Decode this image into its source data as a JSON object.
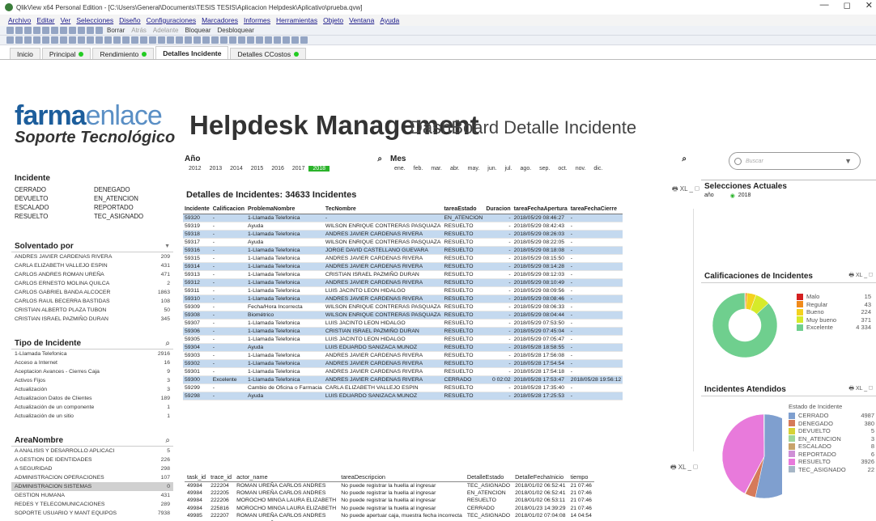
{
  "window": {
    "title": "QlikView x64 Personal Edition - [C:\\Users\\General\\Documents\\TESIS TESIS\\Aplicacion Helpdesk\\Aplicativo\\prueba.qvw]",
    "min": "—",
    "max": "◻",
    "close": "✕"
  },
  "menu": [
    "Archivo",
    "Editar",
    "Ver",
    "Selecciones",
    "Diseño",
    "Configuraciones",
    "Marcadores",
    "Informes",
    "Herramientas",
    "Objeto",
    "Ventana",
    "Ayuda"
  ],
  "toolbar": {
    "borrar": "Borrar",
    "atras": "Atrás",
    "adelante": "Adelante",
    "bloquear": "Bloquear",
    "desbloquear": "Desbloquear"
  },
  "tabs": [
    {
      "label": "Inicio",
      "dot": false
    },
    {
      "label": "Principal",
      "dot": true
    },
    {
      "label": "Rendimiento",
      "dot": true
    },
    {
      "label": "Detalles Incidente",
      "dot": false,
      "active": true
    },
    {
      "label": "Detalles CCostos",
      "dot": true
    }
  ],
  "logo": {
    "farma": "farma",
    "enlace": "enlace",
    "sub": "Soporte Tecnológico"
  },
  "title": "Helpdesk Management",
  "subtitle": "DashBoard Detalle Incidente",
  "search": {
    "placeholder": "Buscar"
  },
  "anio": {
    "label": "Año",
    "values": [
      "2012",
      "2013",
      "2014",
      "2015",
      "2016",
      "2017",
      "2018"
    ],
    "selected": "2018"
  },
  "mes": {
    "label": "Mes",
    "values": [
      "ene.",
      "feb.",
      "mar.",
      "abr.",
      "may.",
      "jun.",
      "jul.",
      "ago.",
      "sep.",
      "oct.",
      "nov.",
      "dic."
    ]
  },
  "incidente": {
    "label": "Incidente",
    "items": [
      "CERRADO",
      "DENEGADO",
      "DEVUELTO",
      "EN_ATENCION",
      "ESCALADO",
      "REPORTADO",
      "RESUELTO",
      "TEC_ASIGNADO"
    ]
  },
  "solventado": {
    "label": "Solventado por",
    "rows": [
      [
        "ANDRES JAVIER CARDENAS RIVERA",
        "209"
      ],
      [
        "CARLA ELIZABETH VALLEJO ESPIN",
        "431"
      ],
      [
        "CARLOS ANDRES ROMAN UREÑA",
        "471"
      ],
      [
        "CARLOS ERNESTO MOLINA QUILCA",
        "2"
      ],
      [
        "CARLOS GABRIEL BANDA ALCOCER",
        "1863"
      ],
      [
        "CARLOS RAUL BECERRA BASTIDAS",
        "108"
      ],
      [
        "CRISTIAN ALBERTO PLAZA TUBON",
        "50"
      ],
      [
        "CRISTIAN ISRAEL PAZMIÑO DURAN",
        "345"
      ]
    ]
  },
  "tipo": {
    "label": "Tipo de Incidente",
    "rows": [
      [
        "1-Llamada Telefonica",
        "2916"
      ],
      [
        "Acceso a Internet",
        "16"
      ],
      [
        "Aceptacion Avances - Cierres Caja",
        "9"
      ],
      [
        "Activos Fijos",
        "3"
      ],
      [
        "Actualización",
        "3"
      ],
      [
        "Actualizacion Datos de Clientes",
        "189"
      ],
      [
        "Actualización de un componente",
        "1"
      ],
      [
        "Actualización de un sitio",
        "1"
      ]
    ]
  },
  "area": {
    "label": "AreaNombre",
    "rows": [
      [
        "A ANALISIS Y DESARROLLO APLICACI",
        "5"
      ],
      [
        "A GESTION DE IDENTIDADES",
        "226"
      ],
      [
        "A SEGURIDAD",
        "298"
      ],
      [
        "ADMINISTRACION OPERACIONES",
        "107"
      ],
      [
        "ADMINISTRACION SISTEMAS",
        "0"
      ],
      [
        "GESTION HUMANA",
        "431"
      ],
      [
        "REDES Y TELECOMUNICACIONES",
        "289"
      ],
      [
        "SOPORTE USUARIO Y MANT EQUIPOS",
        "7938"
      ]
    ]
  },
  "detalle": {
    "title": "Detalles de Incidentes: 34633 Incidentes",
    "icons": "🖶 XL _ ◻",
    "headers": [
      "Incidente",
      "Calificacion",
      "ProblemaNombre",
      "TecNombre",
      "tareaEstado",
      "Duracion",
      "tareaFechaApertura",
      "tareaFechaCierre"
    ],
    "rows": [
      [
        "59320",
        "-",
        "1-Llamada Telefonica",
        "-",
        "EN_ATENCION",
        "-",
        "2018/05/29 08:46:27",
        "-"
      ],
      [
        "59319",
        "-",
        "Ayuda",
        "WILSON ENRIQUE CONTRERAS PASQUAZA",
        "RESUELTO",
        "-",
        "2018/05/29 08:42:43",
        "-"
      ],
      [
        "59318",
        "-",
        "1-Llamada Telefonica",
        "ANDRES JAVIER CARDENAS RIVERA",
        "RESUELTO",
        "-",
        "2018/05/29 08:26:03",
        "-"
      ],
      [
        "59317",
        "-",
        "Ayuda",
        "WILSON ENRIQUE CONTRERAS PASQUAZA",
        "RESUELTO",
        "-",
        "2018/05/29 08:22:05",
        "-"
      ],
      [
        "59316",
        "-",
        "1-Llamada Telefonica",
        "JORGE DAVID CASTELLANO GUEVARA",
        "RESUELTO",
        "-",
        "2018/05/29 08:18:08",
        "-"
      ],
      [
        "59315",
        "-",
        "1-Llamada Telefonica",
        "ANDRES JAVIER CARDENAS RIVERA",
        "RESUELTO",
        "-",
        "2018/05/29 08:15:50",
        "-"
      ],
      [
        "59314",
        "-",
        "1-Llamada Telefonica",
        "ANDRES JAVIER CARDENAS RIVERA",
        "RESUELTO",
        "-",
        "2018/05/29 08:14:28",
        "-"
      ],
      [
        "59313",
        "-",
        "1-Llamada Telefonica",
        "CRISTIAN ISRAEL PAZMIÑO DURAN",
        "RESUELTO",
        "-",
        "2018/05/29 08:12:03",
        "-"
      ],
      [
        "59312",
        "-",
        "1-Llamada Telefonica",
        "ANDRES JAVIER CARDENAS RIVERA",
        "RESUELTO",
        "-",
        "2018/05/29 08:10:49",
        "-"
      ],
      [
        "59311",
        "-",
        "1-Llamada Telefonica",
        "LUIS JACINTO LEON HIDALGO",
        "RESUELTO",
        "-",
        "2018/05/29 08:09:56",
        "-"
      ],
      [
        "59310",
        "-",
        "1-Llamada Telefonica",
        "ANDRES JAVIER CARDENAS RIVERA",
        "RESUELTO",
        "-",
        "2018/05/29 08:08:46",
        "-"
      ],
      [
        "59309",
        "-",
        "Fecha/Hora Incorrecta",
        "WILSON ENRIQUE CONTRERAS PASQUAZA",
        "RESUELTO",
        "-",
        "2018/05/29 08:06:33",
        "-"
      ],
      [
        "59308",
        "-",
        "Biométrico",
        "WILSON ENRIQUE CONTRERAS PASQUAZA",
        "RESUELTO",
        "-",
        "2018/05/29 08:04:44",
        "-"
      ],
      [
        "59307",
        "-",
        "1-Llamada Telefonica",
        "LUIS JACINTO LEON HIDALGO",
        "RESUELTO",
        "-",
        "2018/05/29 07:53:50",
        "-"
      ],
      [
        "59306",
        "-",
        "1-Llamada Telefonica",
        "CRISTIAN ISRAEL PAZMIÑO DURAN",
        "RESUELTO",
        "-",
        "2018/05/29 07:45:04",
        "-"
      ],
      [
        "59305",
        "-",
        "1-Llamada Telefonica",
        "LUIS JACINTO LEON HIDALGO",
        "RESUELTO",
        "-",
        "2018/05/29 07:05:47",
        "-"
      ],
      [
        "59304",
        "-",
        "Ayuda",
        "LUIS EDUARDO SANIZACA MUNOZ",
        "RESUELTO",
        "-",
        "2018/05/28 18:58:55",
        "-"
      ],
      [
        "59303",
        "-",
        "1-Llamada Telefonica",
        "ANDRES JAVIER CARDENAS RIVERA",
        "RESUELTO",
        "-",
        "2018/05/28 17:56:08",
        "-"
      ],
      [
        "59302",
        "-",
        "1-Llamada Telefonica",
        "ANDRES JAVIER CARDENAS RIVERA",
        "RESUELTO",
        "-",
        "2018/05/28 17:54:54",
        "-"
      ],
      [
        "59301",
        "-",
        "1-Llamada Telefonica",
        "ANDRES JAVIER CARDENAS RIVERA",
        "RESUELTO",
        "-",
        "2018/05/28 17:54:18",
        "-"
      ],
      [
        "59300",
        "Excelente",
        "1-Llamada Telefonica",
        "ANDRES JAVIER CARDENAS RIVERA",
        "CERRADO",
        "0 02:02",
        "2018/05/28 17:53:47",
        "2018/05/28 19:56:12"
      ],
      [
        "59299",
        "-",
        "Cambio de Oficina o Farmacia",
        "CARLA ELIZABETH VALLEJO ESPIN",
        "RESUELTO",
        "-",
        "2018/05/28 17:35:40",
        "-"
      ],
      [
        "59298",
        "-",
        "Ayuda",
        "LUIS EDUARDO SANIZACA MUNOZ",
        "RESUELTO",
        "-",
        "2018/05/28 17:25:53",
        "-"
      ]
    ]
  },
  "tareas": {
    "icons": "🖶 XL _ ◻",
    "headers": [
      "task_id",
      "trace_id",
      "actor_name",
      "tareaDescripcion",
      "DetalleEstado",
      "DetalleFechaInicio",
      "tiempo"
    ],
    "rows": [
      [
        "49984",
        "222204",
        "ROMAN UREÑA CARLOS ANDRES",
        "No puede registrar la huella al ingresar",
        "TEC_ASIGNADO",
        "2018/01/02 06:52:41",
        "21 07:46"
      ],
      [
        "49984",
        "222205",
        "ROMAN UREÑA CARLOS ANDRES",
        "No puede registrar la huella al ingresar",
        "EN_ATENCION",
        "2018/01/02 06:52:41",
        "21 07:46"
      ],
      [
        "49984",
        "222206",
        "MOROCHO MINGA LAURA ELIZABETH",
        "No puede registrar la huella al ingresar",
        "RESUELTO",
        "2018/01/02 06:53:11",
        "21 07:46"
      ],
      [
        "49984",
        "225816",
        "MOROCHO MINGA LAURA ELIZABETH",
        "No puede registrar la huella al ingresar",
        "CERRADO",
        "2018/01/23 14:39:29",
        "21 07:46"
      ],
      [
        "49985",
        "222207",
        "ROMAN UREÑA CARLOS ANDRES",
        "No puede apertuar caja, muestra fecha incorrecta",
        "TEC_ASIGNADO",
        "2018/01/02 07:04:08",
        "14 04:54"
      ],
      [
        "49985",
        "222208",
        "ROMAN UREÑA CARLOS ANDRES",
        "No puede apertuar caja, muestra fecha incorrecta",
        "EN_ATENCION",
        "2018/01/02 07:04:10",
        "14 04:54"
      ]
    ]
  },
  "selecciones": {
    "title": "Selecciones Actuales",
    "field": "año",
    "value": "2018"
  },
  "calificaciones": {
    "title": "Calificaciones de Incidentes",
    "icons": "🖶 XL _ ◻"
  },
  "atendidos": {
    "title": "Incidentes Atendidos",
    "icons": "🖶 XL _ ◻",
    "legend_title": "Estado de Incidente"
  },
  "chart_data": [
    {
      "type": "pie",
      "title": "Calificaciones de Incidentes",
      "labels": [
        "Malo",
        "Regular",
        "Bueno",
        "Muy bueno",
        "Excelente"
      ],
      "values": [
        15,
        43,
        224,
        371,
        4334
      ],
      "display_values": [
        "15",
        "43",
        "224",
        "371",
        "4 334"
      ],
      "colors": [
        "#d42020",
        "#f08a1a",
        "#f4d21e",
        "#d6ea2a",
        "#6fcf8e"
      ]
    },
    {
      "type": "pie",
      "title": "Incidentes Atendidos",
      "legend_title": "Estado de Incidente",
      "labels": [
        "CERRADO",
        "DENEGADO",
        "DEVUELTO",
        "EN_ATENCION",
        "ESCALADO",
        "REPORTADO",
        "RESUELTO",
        "TEC_ASIGNADO"
      ],
      "values": [
        4987,
        380,
        5,
        3,
        8,
        6,
        3926,
        22
      ],
      "colors": [
        "#7f9fcf",
        "#d67a5a",
        "#d6d236",
        "#9fd69a",
        "#c8a36b",
        "#cf8fd6",
        "#e87adb",
        "#a6b6c6"
      ]
    }
  ]
}
